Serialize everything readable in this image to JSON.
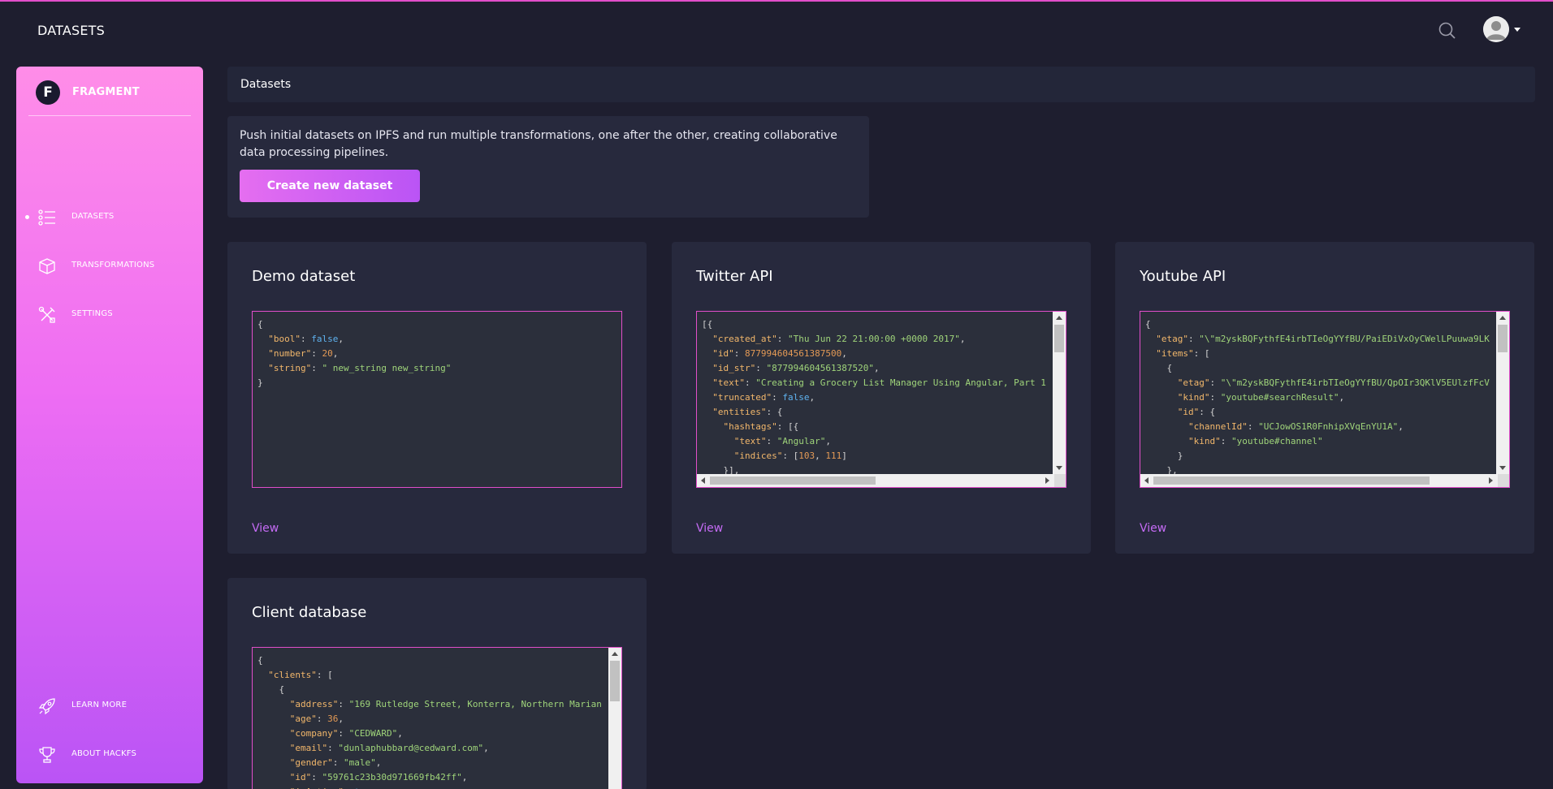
{
  "navbar": {
    "title": "DATASETS",
    "search_icon": "search-icon",
    "user_icon": "user-avatar"
  },
  "sidebar": {
    "logo_letter": "F",
    "logo_text": "FRAGMENT",
    "items": [
      {
        "label": "DATASETS",
        "icon": "list-icon",
        "active": true
      },
      {
        "label": "TRANSFORMATIONS",
        "icon": "cube-icon",
        "active": false
      },
      {
        "label": "SETTINGS",
        "icon": "tools-icon",
        "active": false
      }
    ],
    "bottom_items": [
      {
        "label": "LEARN MORE",
        "icon": "rocket-icon"
      },
      {
        "label": "ABOUT HACKFS",
        "icon": "trophy-icon"
      }
    ]
  },
  "main": {
    "breadcrumb": "Datasets",
    "intro_text": "Push initial datasets on IPFS and run multiple transformations, one after the other, creating collaborative data processing pipelines.",
    "create_button": "Create new dataset",
    "view_label": "View",
    "datasets": [
      {
        "title": "Demo dataset"
      },
      {
        "title": "Twitter API"
      },
      {
        "title": "Youtube API"
      },
      {
        "title": "Client database"
      }
    ]
  },
  "colors": {
    "background": "#1e1e2f",
    "card": "#27293d",
    "accent": "#e14eca",
    "sidebar_top": "#ff8de8",
    "sidebar_bottom": "#ba54f5",
    "link": "#c56bf5"
  }
}
